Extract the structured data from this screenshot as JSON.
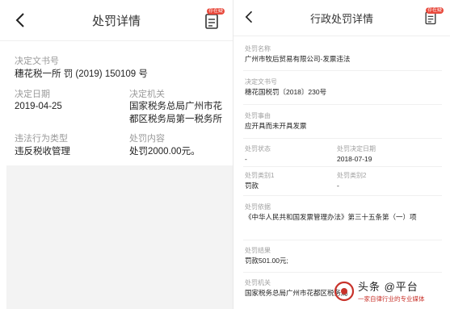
{
  "left": {
    "title": "处罚详情",
    "badge": "存在疑",
    "decision_no_label": "决定文书号",
    "decision_no": "穗花税一所 罚 (2019) 150109 号",
    "date_label": "决定日期",
    "date": "2019-04-25",
    "authority_label": "决定机关",
    "authority": "国家税务总局广州市花都区税务局第一税务所",
    "violation_label": "违法行为类型",
    "violation": "违反税收管理",
    "content_label": "处罚内容",
    "content": "处罚2000.00元。"
  },
  "right": {
    "title": "行政处罚详情",
    "badge": "存在疑",
    "party_label": "处罚名称",
    "party": "广州市牧后贸易有限公司-发票违法",
    "doc_no_label": "决定文书号",
    "doc_no": "穗花国税罚〔2018〕230号",
    "reason_label": "处罚事由",
    "reason": "应开具而未开具发票",
    "status_label": "处罚状态",
    "status": "-",
    "date_label": "处罚决定日期",
    "date": "2018-07-19",
    "type1_label": "处罚类别1",
    "type1": "罚款",
    "type2_label": "处罚类别2",
    "type2": "-",
    "basis_label": "处罚依据",
    "basis": "《中华人民共和国发票管理办法》第三十五条第（一）项",
    "result_label": "处罚结果",
    "result": "罚款501.00元;",
    "authority_label": "处罚机关",
    "authority": "国家税务总局广州市花都区税务局"
  },
  "watermark": {
    "line1": "头条 @平台",
    "line2": "一家自律行业的专业媒体"
  },
  "icons": [
    "back-arrow-icon",
    "document-icon",
    "watermark-logo-icon"
  ],
  "colors": {
    "badge": "#e8493c",
    "panel_gray": "#f3f3f3",
    "watermark_red": "#c8322a"
  }
}
